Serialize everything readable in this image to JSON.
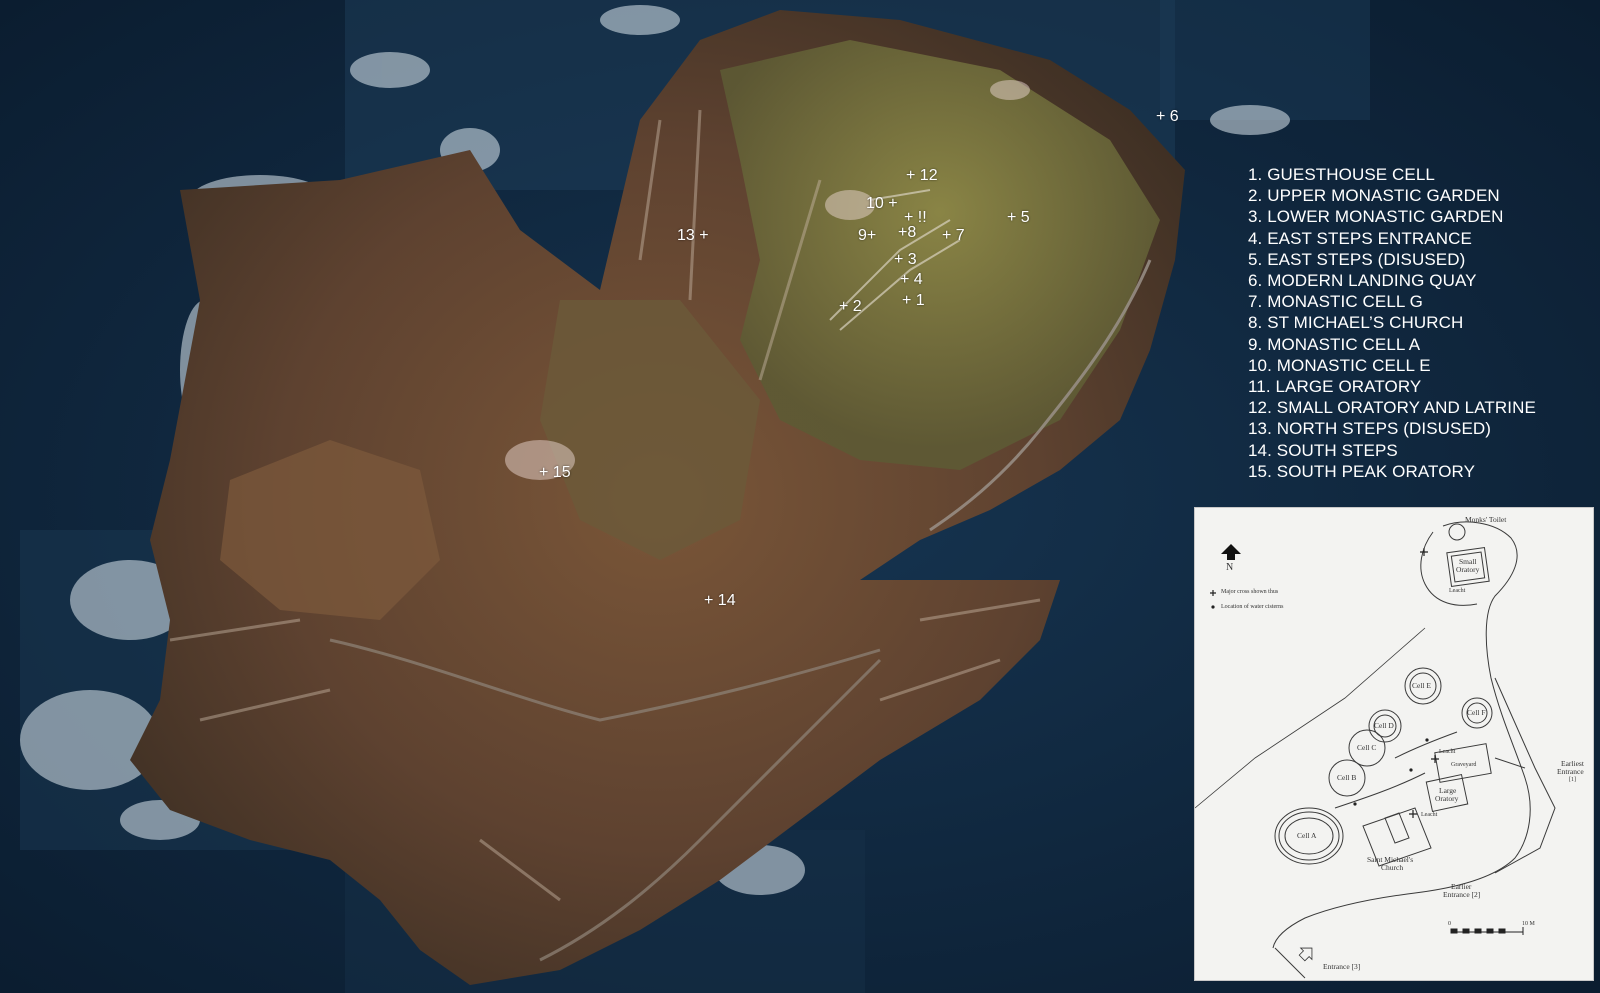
{
  "map": {
    "site_markers": [
      {
        "id": "1",
        "text": "+ 1"
      },
      {
        "id": "2",
        "text": "+ 2"
      },
      {
        "id": "3",
        "text": "+ 3"
      },
      {
        "id": "4",
        "text": "+ 4"
      },
      {
        "id": "5",
        "text": "+ 5"
      },
      {
        "id": "6",
        "text": "+ 6"
      },
      {
        "id": "7",
        "text": "+ 7"
      },
      {
        "id": "8",
        "text": "+8"
      },
      {
        "id": "9",
        "text": "9+"
      },
      {
        "id": "10",
        "text": "10 +"
      },
      {
        "id": "11",
        "text": "+ !!"
      },
      {
        "id": "12",
        "text": "+ 12"
      },
      {
        "id": "13",
        "text": "13 +"
      },
      {
        "id": "14",
        "text": "+ 14"
      },
      {
        "id": "15",
        "text": "+ 15"
      }
    ],
    "legend": [
      "1. GUESTHOUSE CELL",
      "2. UPPER MONASTIC GARDEN",
      "3. LOWER MONASTIC GARDEN",
      "4. EAST STEPS ENTRANCE",
      "5. EAST STEPS (DISUSED)",
      "6. MODERN LANDING QUAY",
      "7. MONASTIC CELL G",
      "8. ST MICHAEL’S CHURCH",
      "9. MONASTIC CELL A",
      "10. MONASTIC CELL E",
      "11. LARGE ORATORY",
      "12. SMALL ORATORY AND LATRINE",
      "13. NORTH STEPS (DISUSED)",
      "14. SOUTH STEPS",
      "15. SOUTH PEAK ORATORY"
    ],
    "colors": {
      "sea": "#0d2338",
      "rock": "#6b4a30",
      "grass": "#7d7a3a",
      "surf": "#e6eef2",
      "label": "#ffffff",
      "plan_paper": "#f3f3f1",
      "plan_ink": "#3a3a3a"
    }
  },
  "plan": {
    "north_label": "N",
    "legend_cross": "Major cross shown thus",
    "legend_dot": "Location of water cisterns",
    "labels": {
      "monks_toilet": "Monks' Toilet",
      "small_oratory_1": "Small",
      "small_oratory_2": "Oratory",
      "leacht_1": "Leacht",
      "cell_e": "Cell E",
      "cell_f": "Cell F",
      "cell_d": "Cell D",
      "cell_c": "Cell C",
      "cell_b": "Cell B",
      "cell_a": "Cell A",
      "leacht_2": "Leacht",
      "graveyard": "Graveyard",
      "large_oratory_1": "Large",
      "large_oratory_2": "Oratory",
      "leacht_3": "Leacht",
      "church_1": "Saint Michael's",
      "church_2": "Church",
      "earliest_1": "Earliest",
      "earliest_2": "Entrance",
      "earliest_3": "[1]",
      "earlier_1": "Earlier",
      "earlier_2": "Entrance [2]",
      "entrance_3": "Entrance [3]",
      "scale_0": "0",
      "scale_10": "10 M"
    }
  }
}
